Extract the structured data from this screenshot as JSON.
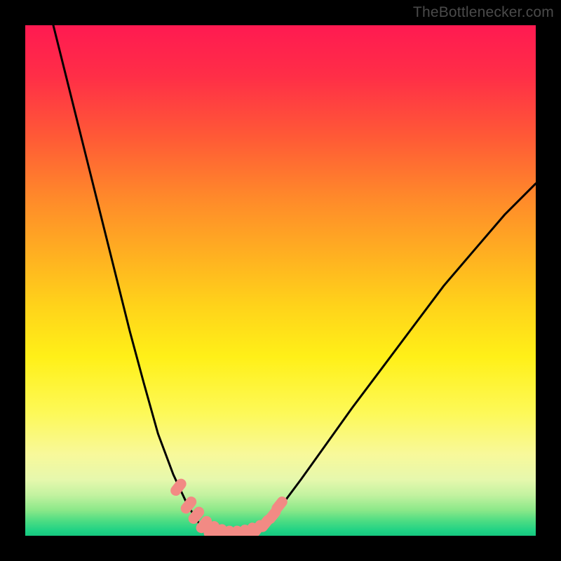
{
  "watermark": "TheBottlenecker.com",
  "chart_data": {
    "type": "line",
    "title": "",
    "xlabel": "",
    "ylabel": "",
    "xlim": [
      0,
      1
    ],
    "ylim": [
      0,
      1
    ],
    "notes": "Background vertical gradient encodes match quality: red (top, poor) → green (bottom, ideal). The black curves form a V-shaped bottleneck profile; small salmon bead markers cluster near the trough.",
    "series": [
      {
        "name": "left-curve",
        "stroke": "#000000",
        "points": [
          [
            0.055,
            1.0
          ],
          [
            0.08,
            0.9
          ],
          [
            0.105,
            0.8
          ],
          [
            0.13,
            0.7
          ],
          [
            0.155,
            0.6
          ],
          [
            0.18,
            0.5
          ],
          [
            0.205,
            0.4
          ],
          [
            0.232,
            0.3
          ],
          [
            0.26,
            0.2
          ],
          [
            0.29,
            0.12
          ],
          [
            0.318,
            0.06
          ],
          [
            0.34,
            0.025
          ],
          [
            0.36,
            0.01
          ]
        ]
      },
      {
        "name": "floor",
        "stroke": "#000000",
        "points": [
          [
            0.36,
            0.01
          ],
          [
            0.395,
            0.003
          ],
          [
            0.43,
            0.005
          ],
          [
            0.46,
            0.015
          ]
        ]
      },
      {
        "name": "right-curve",
        "stroke": "#000000",
        "points": [
          [
            0.46,
            0.015
          ],
          [
            0.495,
            0.05
          ],
          [
            0.54,
            0.11
          ],
          [
            0.59,
            0.18
          ],
          [
            0.64,
            0.25
          ],
          [
            0.7,
            0.33
          ],
          [
            0.76,
            0.41
          ],
          [
            0.82,
            0.49
          ],
          [
            0.88,
            0.56
          ],
          [
            0.94,
            0.63
          ],
          [
            1.0,
            0.69
          ]
        ]
      },
      {
        "name": "beads",
        "type": "scatter",
        "fill": "#f28a84",
        "points": [
          [
            0.3,
            0.095
          ],
          [
            0.32,
            0.06
          ],
          [
            0.335,
            0.04
          ],
          [
            0.35,
            0.022
          ],
          [
            0.365,
            0.012
          ],
          [
            0.38,
            0.006
          ],
          [
            0.395,
            0.003
          ],
          [
            0.41,
            0.003
          ],
          [
            0.425,
            0.005
          ],
          [
            0.44,
            0.009
          ],
          [
            0.455,
            0.014
          ],
          [
            0.47,
            0.024
          ],
          [
            0.485,
            0.04
          ],
          [
            0.498,
            0.06
          ]
        ]
      }
    ]
  }
}
